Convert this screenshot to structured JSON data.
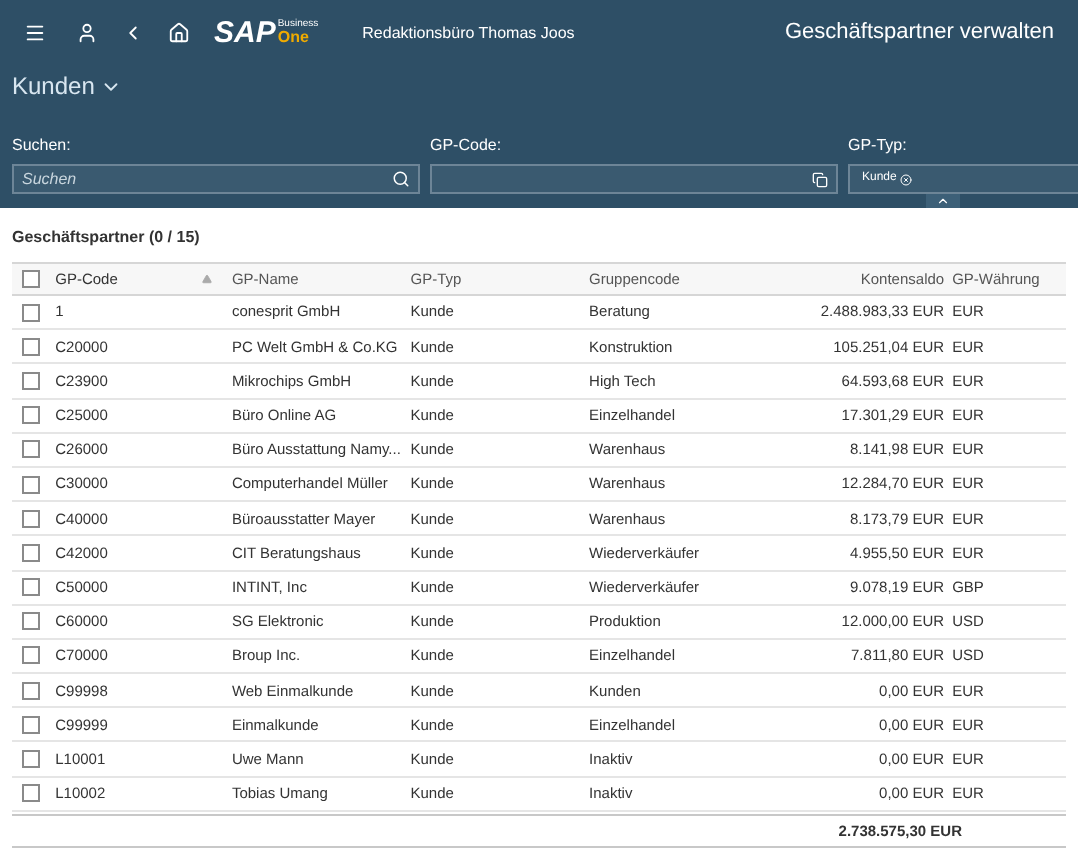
{
  "shell": {
    "company": "Redaktionsbüro Thomas Joos",
    "title": "Geschäftspartner verwalten",
    "logo": {
      "main": "SAP",
      "sub_top": "Business",
      "sub_bottom": "One"
    }
  },
  "variant": {
    "label": "Kunden"
  },
  "filters": [
    {
      "kind": "search",
      "label": "Suchen:",
      "placeholder": "Suchen"
    },
    {
      "kind": "valuehelp",
      "label": "GP-Code:"
    },
    {
      "kind": "tokens",
      "label": "GP-Typ:",
      "tokens": [
        "Kunde"
      ]
    }
  ],
  "table": {
    "title": "Geschäftspartner (0 / 15)",
    "header_checked": false,
    "columns": [
      {
        "label": "GP-Code",
        "sorted": true
      },
      {
        "label": "GP-Name",
        "sorted": false
      },
      {
        "label": "GP-Typ",
        "sorted": false
      },
      {
        "label": "Gruppencode",
        "sorted": false
      },
      {
        "label": "Kontensaldo",
        "sorted": false
      },
      {
        "label": "GP-Währung",
        "sorted": false
      }
    ],
    "rows": [
      {
        "checked": false,
        "cells": [
          "1",
          "conesprit GmbH",
          "Kunde",
          "Beratung",
          "2.488.983,33 EUR",
          "EUR"
        ]
      },
      {
        "checked": false,
        "cells": [
          "C20000",
          "PC Welt GmbH & Co.KG",
          "Kunde",
          "Konstruktion",
          "105.251,04 EUR",
          "EUR"
        ]
      },
      {
        "checked": false,
        "cells": [
          "C23900",
          "Mikrochips GmbH",
          "Kunde",
          "High Tech",
          "64.593,68 EUR",
          "EUR"
        ]
      },
      {
        "checked": false,
        "cells": [
          "C25000",
          "Büro Online AG",
          "Kunde",
          "Einzelhandel",
          "17.301,29 EUR",
          "EUR"
        ]
      },
      {
        "checked": false,
        "cells": [
          "C26000",
          "Büro Ausstattung Namy...",
          "Kunde",
          "Warenhaus",
          "8.141,98 EUR",
          "EUR"
        ]
      },
      {
        "checked": false,
        "cells": [
          "C30000",
          "Computerhandel Müller",
          "Kunde",
          "Warenhaus",
          "12.284,70 EUR",
          "EUR"
        ]
      },
      {
        "checked": false,
        "cells": [
          "C40000",
          "Büroausstatter Mayer",
          "Kunde",
          "Warenhaus",
          "8.173,79 EUR",
          "EUR"
        ]
      },
      {
        "checked": false,
        "cells": [
          "C42000",
          "CIT Beratungshaus",
          "Kunde",
          "Wiederverkäufer",
          "4.955,50 EUR",
          "EUR"
        ]
      },
      {
        "checked": false,
        "cells": [
          "C50000",
          "INTINT, Inc",
          "Kunde",
          "Wiederverkäufer",
          "9.078,19 EUR",
          "GBP"
        ]
      },
      {
        "checked": false,
        "cells": [
          "C60000",
          "SG Elektronic",
          "Kunde",
          "Produktion",
          "12.000,00 EUR",
          "USD"
        ]
      },
      {
        "checked": false,
        "cells": [
          "C70000",
          "Broup Inc.",
          "Kunde",
          "Einzelhandel",
          "7.811,80 EUR",
          "USD"
        ]
      },
      {
        "checked": false,
        "cells": [
          "C99998",
          "Web Einmalkunde",
          "Kunde",
          "Kunden",
          "0,00 EUR",
          "EUR"
        ]
      },
      {
        "checked": false,
        "cells": [
          "C99999",
          "Einmalkunde",
          "Kunde",
          "Einzelhandel",
          "0,00 EUR",
          "EUR"
        ]
      },
      {
        "checked": false,
        "cells": [
          "L10001",
          "Uwe Mann",
          "Kunde",
          "Inaktiv",
          "0,00 EUR",
          "EUR"
        ]
      },
      {
        "checked": false,
        "cells": [
          "L10002",
          "Tobias Umang",
          "Kunde",
          "Inaktiv",
          "0,00 EUR",
          "EUR"
        ]
      }
    ],
    "total": "2.738.575,30 EUR"
  }
}
